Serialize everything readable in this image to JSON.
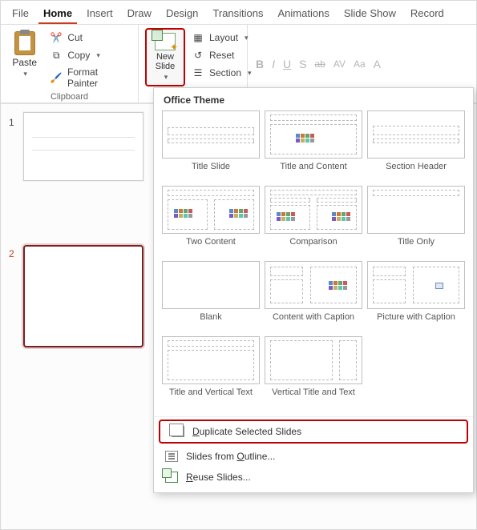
{
  "tabs": {
    "file": "File",
    "home": "Home",
    "insert": "Insert",
    "draw": "Draw",
    "design": "Design",
    "transitions": "Transitions",
    "animations": "Animations",
    "slide_show": "Slide Show",
    "record": "Record"
  },
  "ribbon": {
    "clipboard": {
      "paste": "Paste",
      "cut": "Cut",
      "copy": "Copy",
      "format_painter": "Format Painter",
      "group_label": "Clipboard"
    },
    "slides": {
      "new_slide": "New\nSlide",
      "layout": "Layout",
      "reset": "Reset",
      "section": "Section"
    },
    "font": {
      "b": "B",
      "i": "I",
      "u": "U",
      "s": "S",
      "ab": "ab",
      "av": "AV",
      "aa": "Aa",
      "a_color": "A"
    }
  },
  "slides_panel": {
    "n1": "1",
    "n2": "2"
  },
  "gallery": {
    "title": "Office Theme",
    "layouts": [
      "Title Slide",
      "Title and Content",
      "Section Header",
      "Two Content",
      "Comparison",
      "Title Only",
      "Blank",
      "Content with Caption",
      "Picture with Caption",
      "Title and Vertical Text",
      "Vertical Title and Text"
    ],
    "duplicate": "Duplicate Selected Slides",
    "outline": "Slides from Outline...",
    "reuse": "Reuse Slides..."
  }
}
